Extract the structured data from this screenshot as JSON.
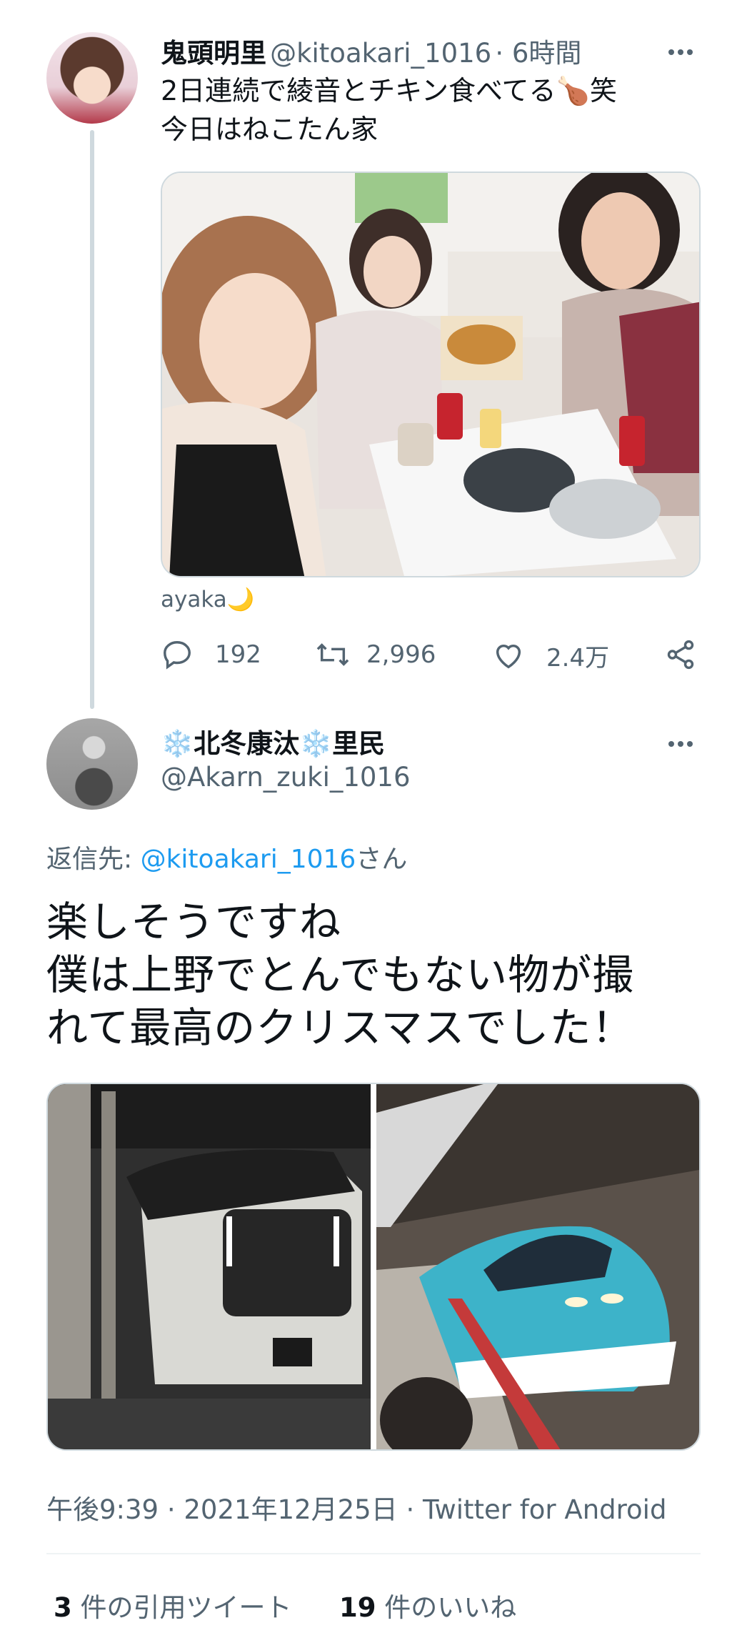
{
  "tweet1": {
    "name": "鬼頭明里",
    "handle": "@kitoakari_1016",
    "time": "· 6時間",
    "line1": "2日連続で綾音とチキン食べてる🍗笑",
    "line2": "今日はねこたん家",
    "caption": "ayaka🌙",
    "replies": "192",
    "retweets": "2,996",
    "likes": "2.4万"
  },
  "tweet2": {
    "name": "❄️北冬康汰❄️里民",
    "handle": "@Akarn_zuki_1016",
    "reply_prefix": "返信先: ",
    "reply_to": "@kitoakari_1016",
    "reply_suffix": "さん",
    "line1": "楽しそうですね",
    "line2": "僕は上野でとんでもない物が撮",
    "line3": "れて最高のクリスマスでした！",
    "timestamp": "午後9:39 · 2021年12月25日 · Twitter for Android",
    "quote_count": "3",
    "quote_label": " 件の引用ツイート",
    "like_count": "19",
    "like_label": " 件のいいね"
  },
  "icons": [
    "more-icon",
    "reply-icon",
    "retweet-icon",
    "like-icon",
    "share-icon"
  ],
  "colors": {
    "accent": "#1d9bf0",
    "muted": "#536471",
    "text": "#0f1419",
    "border": "#cfd9de"
  }
}
